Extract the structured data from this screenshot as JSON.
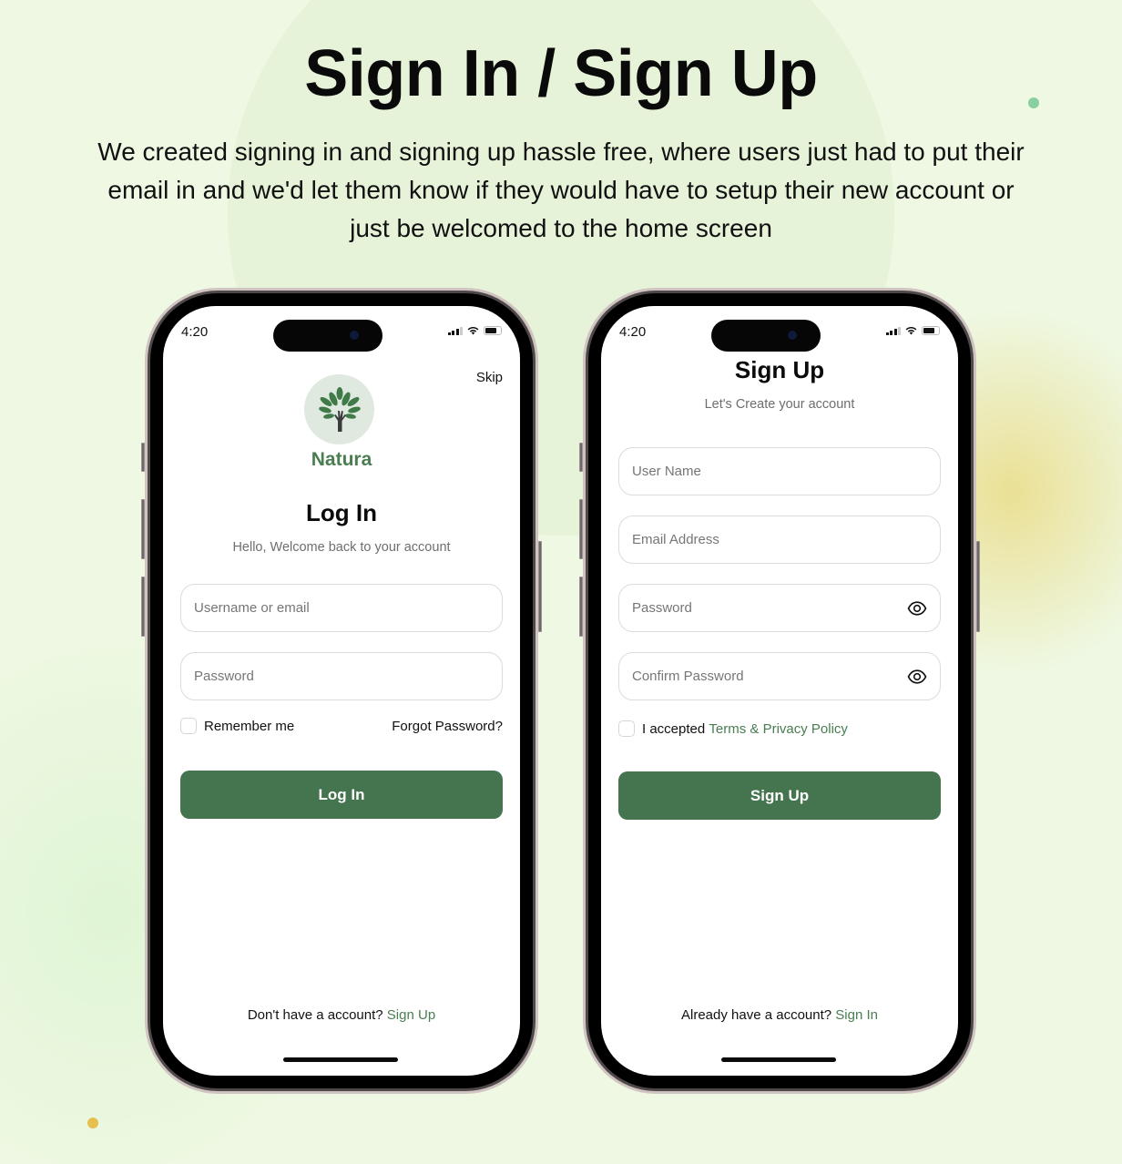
{
  "header": {
    "title": "Sign In / Sign Up",
    "description": "We created signing in and signing up hassle free, where users just had to put their email in and we'd let them know if they would have to setup their new account or just be welcomed to the home screen"
  },
  "colors": {
    "brand_green": "#44754e",
    "link_green": "#4a7d52",
    "background": "#eef8e2",
    "accent_dot_green": "#88d0a0",
    "accent_dot_yellow": "#e6c04e"
  },
  "status_bar": {
    "time": "4:20",
    "icons": [
      "cellular-signal-icon",
      "wifi-icon",
      "battery-icon"
    ]
  },
  "login_screen": {
    "skip_label": "Skip",
    "logo_icon": "tree-hand-icon",
    "brand_name": "Natura",
    "title": "Log In",
    "subtitle": "Hello, Welcome back to your account",
    "username_field": {
      "placeholder": "Username or email",
      "value": ""
    },
    "password_field": {
      "placeholder": "Password",
      "value": ""
    },
    "remember_me_label": "Remember me",
    "remember_me_checked": false,
    "forgot_password_label": "Forgot Password?",
    "submit_label": "Log In",
    "footer_prompt": "Don't have a account?",
    "footer_link": "Sign Up"
  },
  "signup_screen": {
    "title": "Sign Up",
    "subtitle": "Let's Create your account",
    "username_field": {
      "placeholder": "User Name",
      "value": ""
    },
    "email_field": {
      "placeholder": "Email Address",
      "value": ""
    },
    "password_field": {
      "placeholder": "Password",
      "value": "",
      "icon": "eye-icon"
    },
    "confirm_password_field": {
      "placeholder": "Confirm Password",
      "value": "",
      "icon": "eye-icon"
    },
    "terms_prefix": "I accepted",
    "terms_link": "Terms & Privacy Policy",
    "terms_checked": false,
    "submit_label": "Sign Up",
    "footer_prompt": "Already have a account?",
    "footer_link": "Sign In"
  }
}
